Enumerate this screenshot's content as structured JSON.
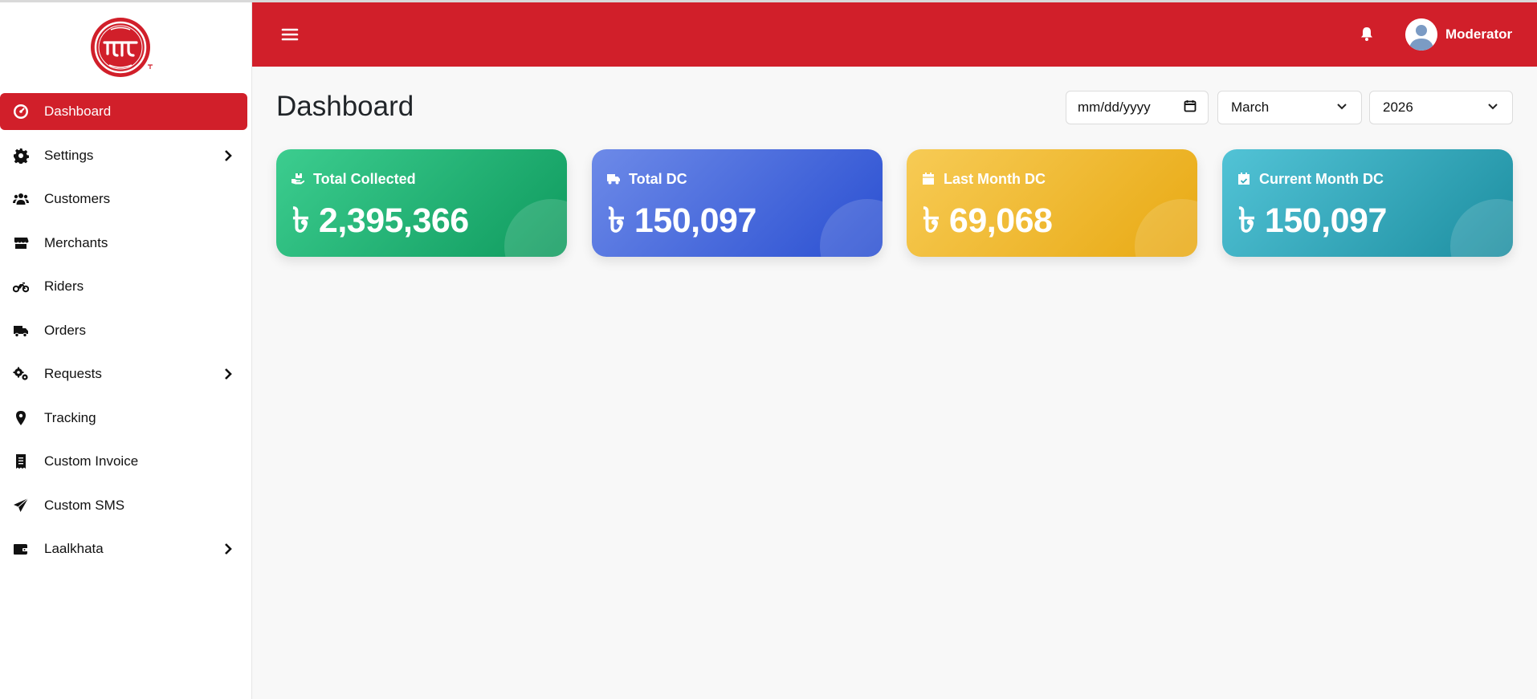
{
  "brand": {
    "accent": "#d11f2a"
  },
  "sidebar": {
    "items": [
      {
        "label": "Dashboard",
        "icon": "dashboard-gauge-icon",
        "active": true
      },
      {
        "label": "Settings",
        "icon": "gear-icon",
        "has_submenu": true
      },
      {
        "label": "Customers",
        "icon": "users-icon"
      },
      {
        "label": "Merchants",
        "icon": "store-icon"
      },
      {
        "label": "Riders",
        "icon": "motorcycle-icon"
      },
      {
        "label": "Orders",
        "icon": "truck-icon"
      },
      {
        "label": "Requests",
        "icon": "gears-icon",
        "has_submenu": true
      },
      {
        "label": "Tracking",
        "icon": "map-pin-icon"
      },
      {
        "label": "Custom Invoice",
        "icon": "receipt-icon"
      },
      {
        "label": "Custom SMS",
        "icon": "paper-plane-icon"
      },
      {
        "label": "Laalkhata",
        "icon": "wallet-icon",
        "has_submenu": true
      }
    ]
  },
  "header": {
    "menu_icon": "hamburger-icon",
    "notification_icon": "bell-icon",
    "user": {
      "name": "Moderator",
      "avatar_icon": "user-avatar-icon"
    }
  },
  "main": {
    "title": "Dashboard",
    "filters": {
      "date_placeholder": "mm/dd/yyyy",
      "month": "March",
      "year": "2026"
    },
    "cards": [
      {
        "label": "Total Collected",
        "currency": "৳",
        "value": "2,395,366",
        "icon": "hand-holding-box-icon",
        "color": "#1fb576"
      },
      {
        "label": "Total DC",
        "currency": "৳",
        "value": "150,097",
        "icon": "truck-icon",
        "color": "#3c63dc"
      },
      {
        "label": "Last Month DC",
        "currency": "৳",
        "value": "69,068",
        "icon": "calendar-icon",
        "color": "#efb928"
      },
      {
        "label": "Current Month DC",
        "currency": "৳",
        "value": "150,097",
        "icon": "calendar-check-icon",
        "color": "#33a9bb"
      }
    ]
  }
}
